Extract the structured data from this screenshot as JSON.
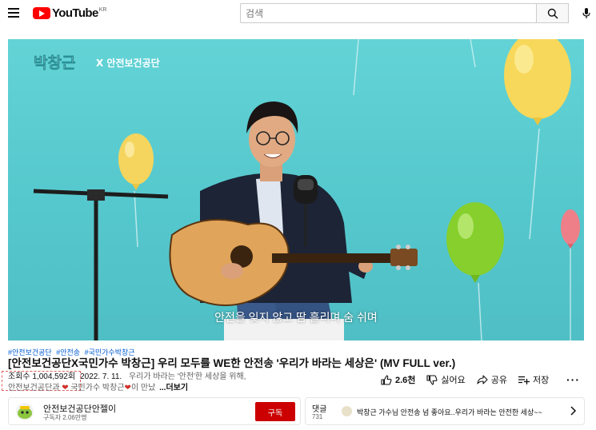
{
  "header": {
    "logo_text": "YouTube",
    "region": "KR",
    "search_placeholder": "검색"
  },
  "video": {
    "overlay_brand": "박창근",
    "overlay_partner": "X 안전보건공단",
    "subtitle": "안전을 잊지 않고 땀 흘리며 숨 쉬며"
  },
  "hashtags": [
    "#안전보건공단",
    "#안전송",
    "#국민가수박창근"
  ],
  "title": "[안전보건공단X국민가수 박창근] 우리 모두를 WE한 안전송 '우리가 바라는 세상은' (MV FULL ver.)",
  "description": {
    "views": "조회수 1,004,592회",
    "date": "2022. 7. 11.",
    "line1_text": "우리가 바라는 '안전'한 세상을 위해,",
    "line2_part1": "안전보건공단과 ",
    "line2_part2": " 국민가수 박창근",
    "line2_part3": "이 만났",
    "more": "...더보기"
  },
  "actions": {
    "like_count": "2.6천",
    "dislike_label": "싫어요",
    "share_label": "공유",
    "save_label": "저장"
  },
  "channel": {
    "name": "안전보건공단안젤이",
    "subscribers": "구독자 2.06만명",
    "subscribe_label": "구독"
  },
  "comments": {
    "label": "댓글",
    "count": "731",
    "top_comment": "박창근 가수님 안전송 넘 좋아요..우리가 바라는 안전한 세상~~"
  },
  "colors": {
    "brand_red": "#ff0000",
    "subscribe_red": "#cc0000",
    "link_blue": "#065fd4",
    "video_bg": "#5ccdd2"
  }
}
